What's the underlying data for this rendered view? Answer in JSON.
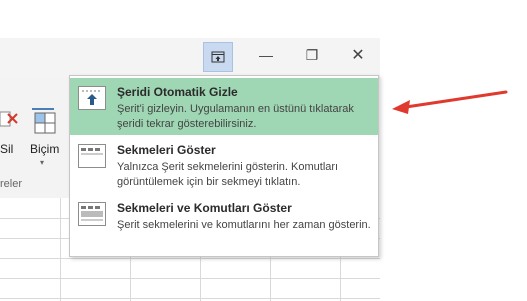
{
  "window": {
    "ribbon_options_icon": "ribbon-display-options-icon",
    "minimize_glyph": "—",
    "maximize_glyph": "❐",
    "close_glyph": "✕"
  },
  "ribbon": {
    "left_label": "Sil",
    "format_label": "Biçim",
    "group_label": "reler"
  },
  "menu": {
    "items": [
      {
        "title": "Şeridi Otomatik Gizle",
        "desc": "Şerit'i gizleyin. Uygulamanın en üstünü tıklatarak şeridi tekrar gösterebilirsiniz.",
        "icon": "auto-hide-ribbon-icon",
        "selected": true
      },
      {
        "title": "Sekmeleri Göster",
        "desc": "Yalnızca Şerit sekmelerini gösterin. Komutları görüntülemek için bir sekmeyi tıklatın.",
        "icon": "show-tabs-icon",
        "selected": false
      },
      {
        "title": "Sekmeleri ve Komutları Göster",
        "desc": "Şerit sekmelerini ve komutlarını her zaman gösterin.",
        "icon": "show-tabs-and-commands-icon",
        "selected": false
      }
    ]
  },
  "colors": {
    "selected_bg": "#9fd6b4",
    "arrow": "#e03a2f",
    "ribbon_button_active": "#c9d9ef"
  }
}
